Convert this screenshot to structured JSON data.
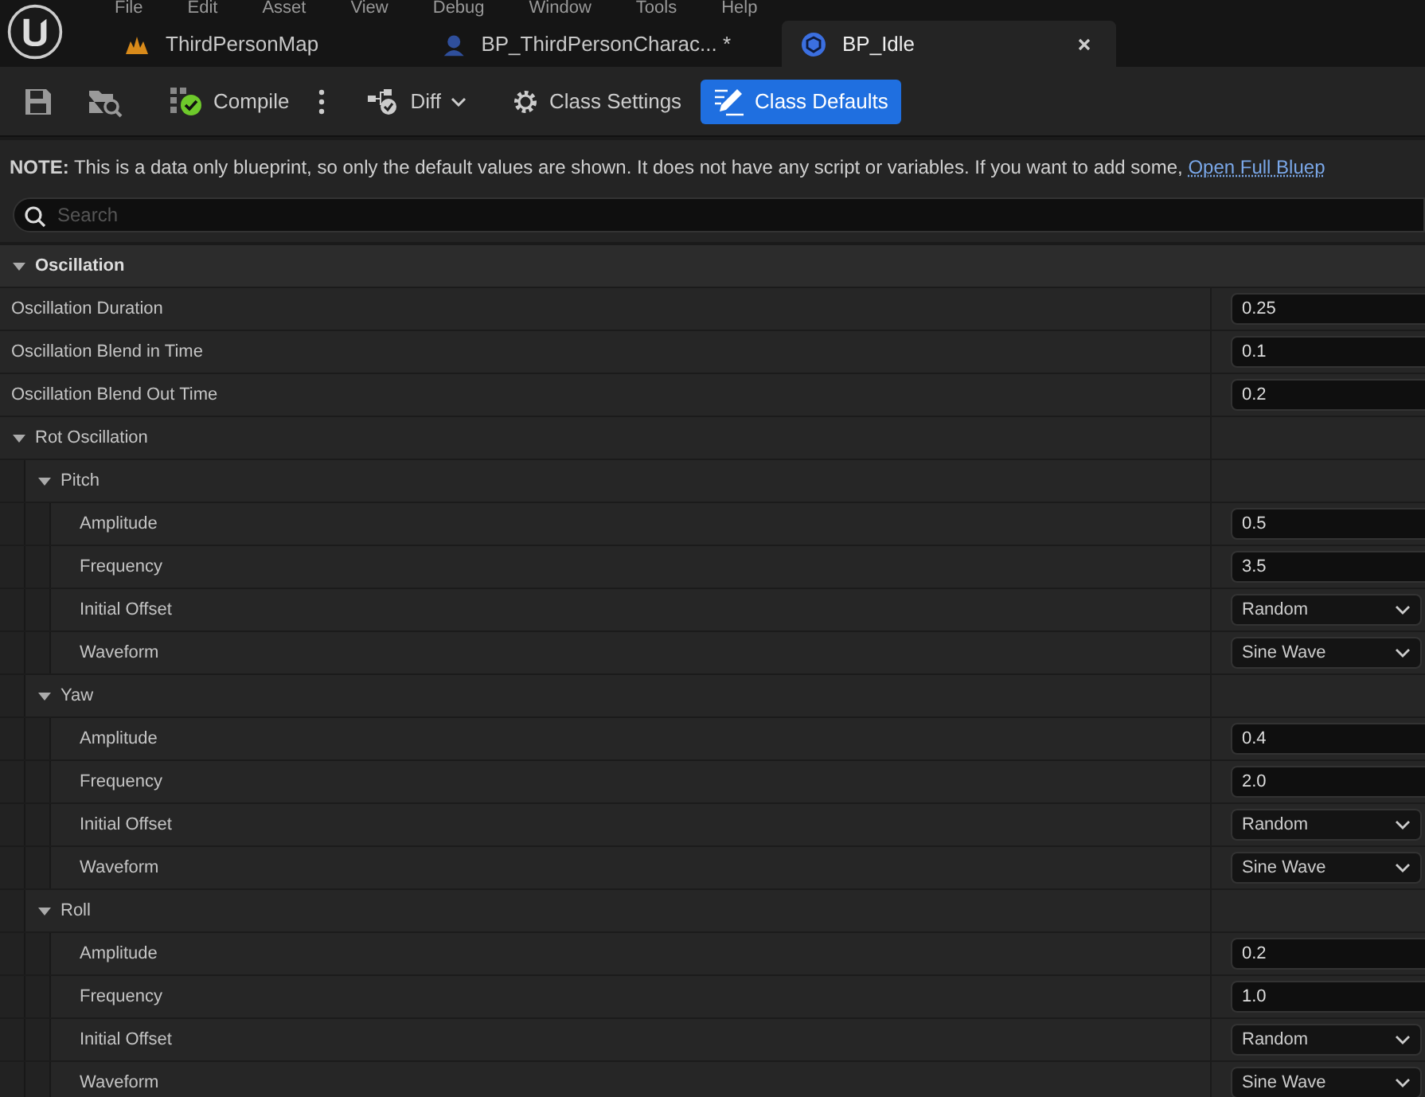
{
  "menu": [
    "File",
    "Edit",
    "Asset",
    "View",
    "Debug",
    "Window",
    "Tools",
    "Help"
  ],
  "tabs": [
    {
      "label": "ThirdPersonMap",
      "kind": "map",
      "selected": false
    },
    {
      "label": "BP_ThirdPersonCharac... *",
      "kind": "character",
      "selected": false
    },
    {
      "label": "BP_Idle",
      "kind": "blueprint",
      "selected": true
    }
  ],
  "toolbar": [
    {
      "kind": "save"
    },
    {
      "kind": "browse"
    },
    {
      "kind": "compile",
      "label": "Compile"
    },
    {
      "kind": "more"
    },
    {
      "kind": "diff",
      "label": "Diff"
    },
    {
      "kind": "settings",
      "label": "Class Settings",
      "selected": false
    },
    {
      "kind": "defaults",
      "label": "Class Defaults",
      "selected": true
    }
  ],
  "note": {
    "text": "**NOTE:** This is a data only blueprint, so only the default values are shown.  It does not have any script or variables.  If you want to add some, ",
    "link": "Open Full Bluep"
  },
  "search": {
    "placeholder": "Search"
  },
  "properties": [
    {
      "label": "Oscillation",
      "kind": "category",
      "expanded": true,
      "children": [
        {
          "label": "Oscillation Duration",
          "kind": "number",
          "value": "0.25"
        },
        {
          "label": "Oscillation Blend in Time",
          "kind": "number",
          "value": "0.1"
        },
        {
          "label": "Oscillation Blend Out Time",
          "kind": "number",
          "value": "0.2"
        },
        {
          "label": "Rot Oscillation",
          "kind": "group",
          "expanded": true,
          "children": [
            {
              "label": "Pitch",
              "kind": "group",
              "expanded": true,
              "children": [
                {
                  "label": "Amplitude",
                  "kind": "number",
                  "value": "0.5"
                },
                {
                  "label": "Frequency",
                  "kind": "number",
                  "value": "3.5"
                },
                {
                  "label": "Initial Offset",
                  "kind": "dropdown",
                  "value": "Random"
                },
                {
                  "label": "Waveform",
                  "kind": "dropdown",
                  "value": "Sine Wave"
                }
              ]
            },
            {
              "label": "Yaw",
              "kind": "group",
              "expanded": true,
              "children": [
                {
                  "label": "Amplitude",
                  "kind": "number",
                  "value": "0.4"
                },
                {
                  "label": "Frequency",
                  "kind": "number",
                  "value": "2.0"
                },
                {
                  "label": "Initial Offset",
                  "kind": "dropdown",
                  "value": "Random"
                },
                {
                  "label": "Waveform",
                  "kind": "dropdown",
                  "value": "Sine Wave"
                }
              ]
            },
            {
              "label": "Roll",
              "kind": "group",
              "expanded": true,
              "children": [
                {
                  "label": "Amplitude",
                  "kind": "number",
                  "value": "0.2"
                },
                {
                  "label": "Frequency",
                  "kind": "number",
                  "value": "1.0"
                },
                {
                  "label": "Initial Offset",
                  "kind": "dropdown",
                  "value": "Random"
                },
                {
                  "label": "Waveform",
                  "kind": "dropdown",
                  "value": "Sine Wave"
                }
              ]
            }
          ]
        }
      ]
    }
  ]
}
